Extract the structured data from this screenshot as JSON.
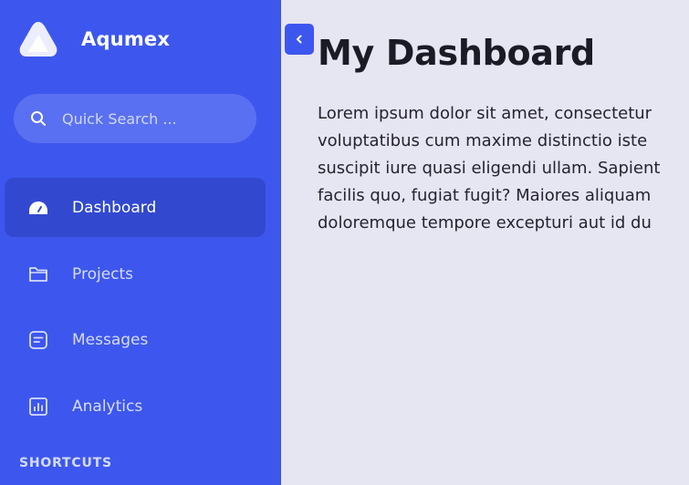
{
  "brand": {
    "name": "Aqumex",
    "logo_icon": "triangle-logo-icon"
  },
  "search": {
    "placeholder": "Quick Search ...",
    "icon": "search-icon"
  },
  "nav": {
    "items": [
      {
        "label": "Dashboard",
        "icon": "gauge-icon",
        "active": true
      },
      {
        "label": "Projects",
        "icon": "folder-icon",
        "active": false
      },
      {
        "label": "Messages",
        "icon": "message-icon",
        "active": false
      },
      {
        "label": "Analytics",
        "icon": "chart-icon",
        "active": false
      }
    ]
  },
  "shortcuts_label": "SHORTCUTS",
  "toggle_icon": "chevron-left-icon",
  "main": {
    "title": "My Dashboard",
    "lines": [
      "Lorem ipsum dolor sit amet, consectetur",
      "voluptatibus cum maxime distinctio iste",
      "suscipit iure quasi eligendi ullam. Sapient",
      "facilis quo, fugiat fugit? Maiores aliquam",
      "doloremque tempore excepturi aut id du"
    ]
  },
  "colors": {
    "sidebar": "#3d57ee",
    "active_item": "#3249cf",
    "search_bg": "#5a70f2",
    "page_bg": "#e6e5f2",
    "text": "#1b1b26"
  }
}
